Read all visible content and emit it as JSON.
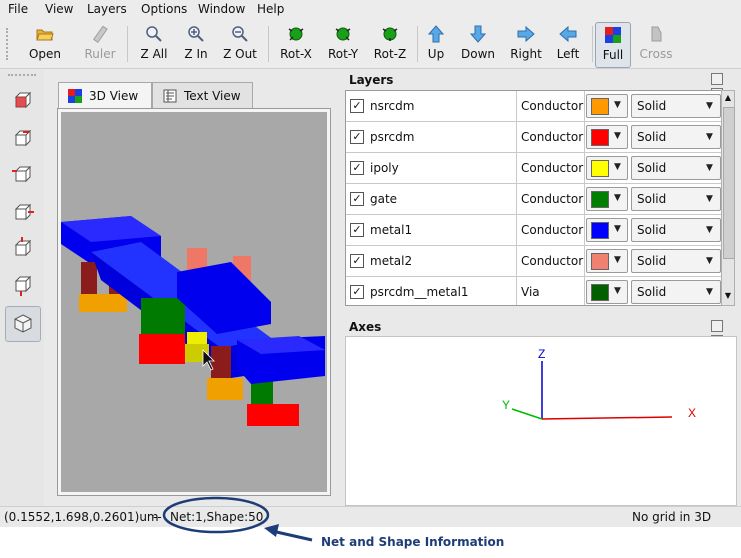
{
  "menubar": {
    "items": [
      "File",
      "View",
      "Layers",
      "Options",
      "Window",
      "Help"
    ]
  },
  "toolbar": {
    "buttons": [
      {
        "label": "Open",
        "icon": "folder-open-icon"
      },
      {
        "label": "Ruler",
        "icon": "ruler-icon",
        "disabled": true
      },
      {
        "label": "Z All",
        "icon": "zoom-all-icon"
      },
      {
        "label": "Z In",
        "icon": "zoom-in-icon"
      },
      {
        "label": "Z Out",
        "icon": "zoom-out-icon"
      },
      {
        "label": "Rot-X",
        "icon": "rotate-x-icon"
      },
      {
        "label": "Rot-Y",
        "icon": "rotate-y-icon"
      },
      {
        "label": "Rot-Z",
        "icon": "rotate-z-icon"
      },
      {
        "label": "Up",
        "icon": "arrow-up-icon"
      },
      {
        "label": "Down",
        "icon": "arrow-down-icon"
      },
      {
        "label": "Right",
        "icon": "arrow-right-icon"
      },
      {
        "label": "Left",
        "icon": "arrow-left-icon"
      },
      {
        "label": "Full",
        "icon": "full-view-icon",
        "active": true
      },
      {
        "label": "Cross",
        "icon": "cross-section-icon",
        "disabled": true
      }
    ]
  },
  "side_tools": [
    "view-front-icon",
    "view-back-icon",
    "view-left-icon",
    "view-right-icon",
    "view-top-icon",
    "view-bottom-icon",
    "view-iso-icon"
  ],
  "tabs": [
    {
      "label": "3D View",
      "icon": "3d-view-icon",
      "selected": true
    },
    {
      "label": "Text View",
      "icon": "text-view-icon",
      "selected": false
    }
  ],
  "layers_panel": {
    "title": "Layers",
    "rows": [
      {
        "checked": true,
        "name": "nsrcdm",
        "type": "Conductor",
        "color": "#ff9900",
        "style": "Solid"
      },
      {
        "checked": true,
        "name": "psrcdm",
        "type": "Conductor",
        "color": "#ff0000",
        "style": "Solid"
      },
      {
        "checked": true,
        "name": "ipoly",
        "type": "Conductor",
        "color": "#ffff00",
        "style": "Solid"
      },
      {
        "checked": true,
        "name": "gate",
        "type": "Conductor",
        "color": "#007f00",
        "style": "Solid"
      },
      {
        "checked": true,
        "name": "metal1",
        "type": "Conductor",
        "color": "#0000ff",
        "style": "Solid"
      },
      {
        "checked": true,
        "name": "metal2",
        "type": "Conductor",
        "color": "#f08070",
        "style": "Solid"
      },
      {
        "checked": true,
        "name": "psrcdm__metal1",
        "type": "Via",
        "color": "#006000",
        "style": "Solid"
      }
    ]
  },
  "axes_panel": {
    "title": "Axes",
    "labels": {
      "z": "Z",
      "y": "Y",
      "x": "X"
    },
    "colors": {
      "z": "#0000cc",
      "y": "#00bb00",
      "x": "#dd0000"
    }
  },
  "status": {
    "coords": "(0.1552,1.698,0.2601)um",
    "separator": "--",
    "net_shape": "Net:1,Shape:50",
    "grid": "No grid in 3D"
  },
  "annotation": {
    "text": "Net and Shape Information",
    "color": "#1e3c78"
  }
}
